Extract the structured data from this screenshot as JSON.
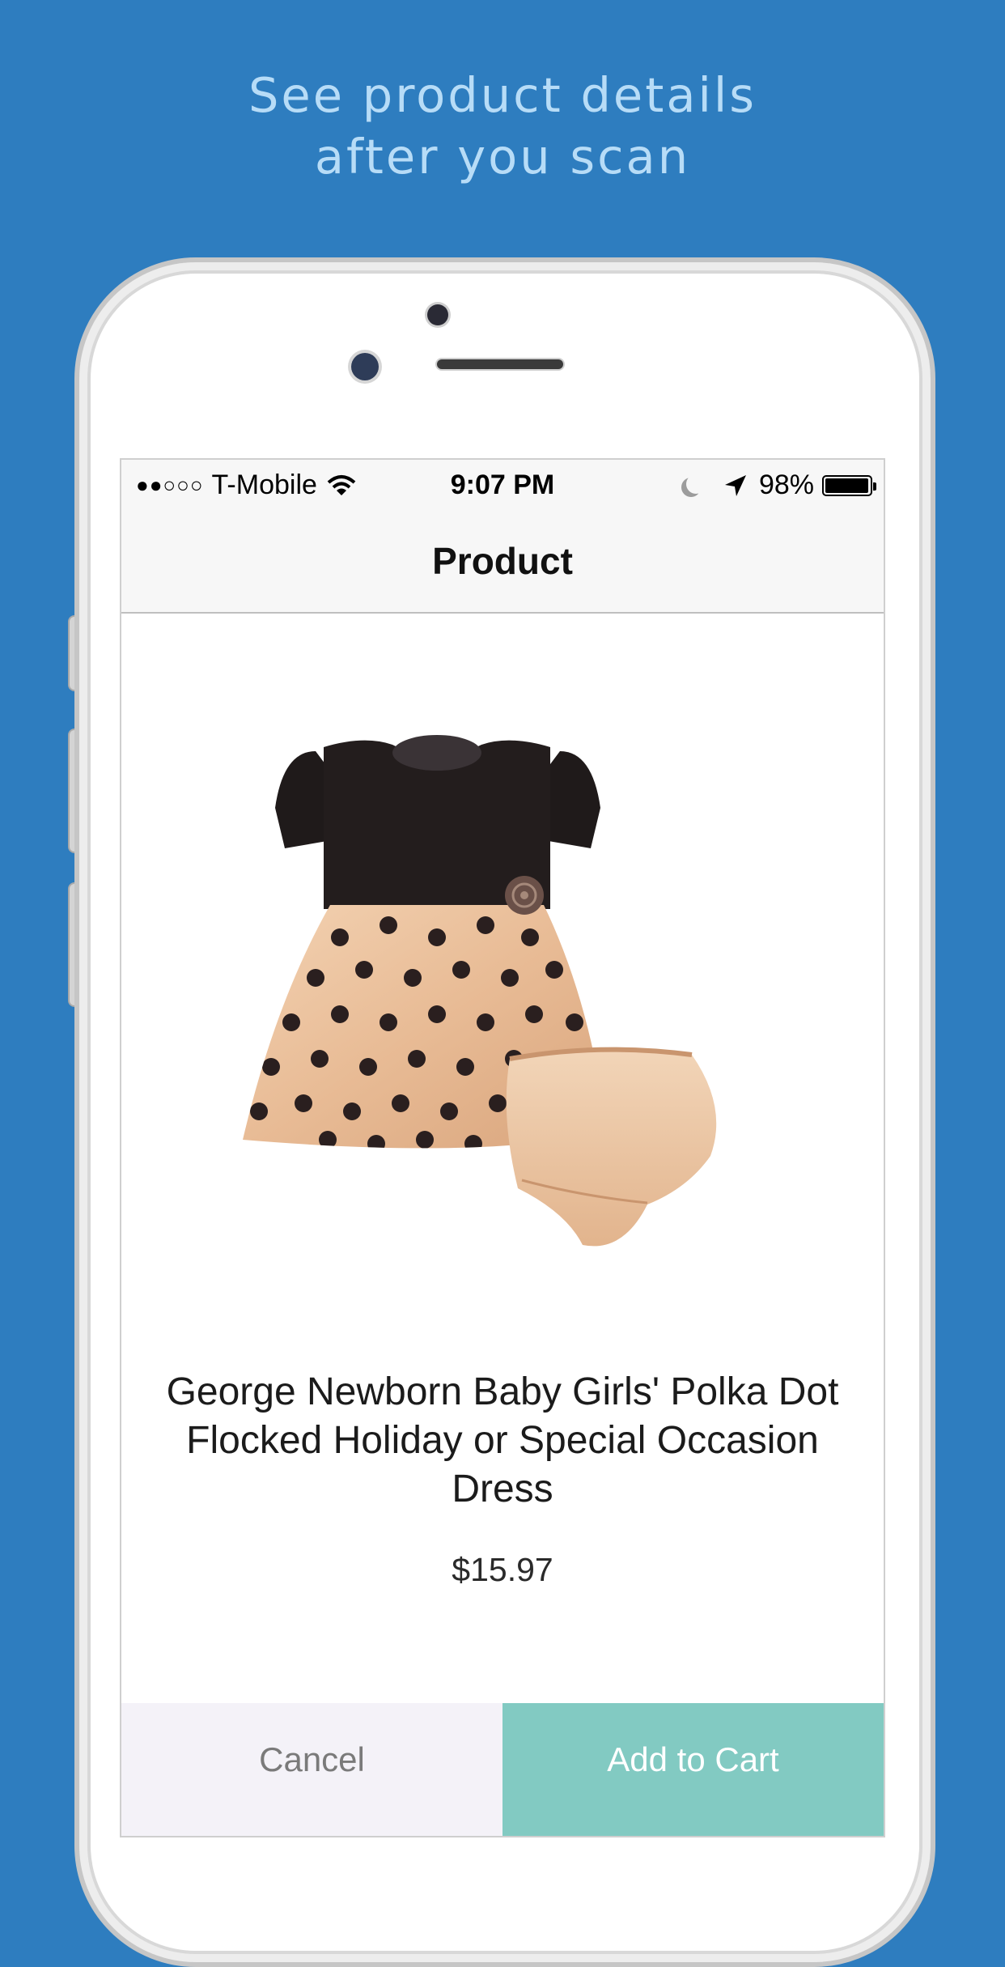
{
  "headline": {
    "line1": "See product details",
    "line2": "after you scan"
  },
  "status_bar": {
    "signal": "●●○○○",
    "carrier": "T-Mobile",
    "wifi_icon": "wifi-icon",
    "time": "9:07 PM",
    "moon_icon": "moon-icon",
    "location_icon": "location-arrow-icon",
    "battery_percent": "98%",
    "battery_level": 0.98
  },
  "navbar": {
    "title": "Product"
  },
  "product": {
    "image_icon": "polka-dot-dress-image",
    "name": "George Newborn Baby Girls' Polka Dot Flocked Holiday or Special Occasion Dress",
    "price": "$15.97"
  },
  "actions": {
    "cancel_label": "Cancel",
    "add_label": "Add to Cart"
  },
  "colors": {
    "background": "#2e7dbf",
    "headline": "#b7dcf7",
    "add_button": "#82cac2",
    "cancel_button": "#f4f2f8"
  }
}
